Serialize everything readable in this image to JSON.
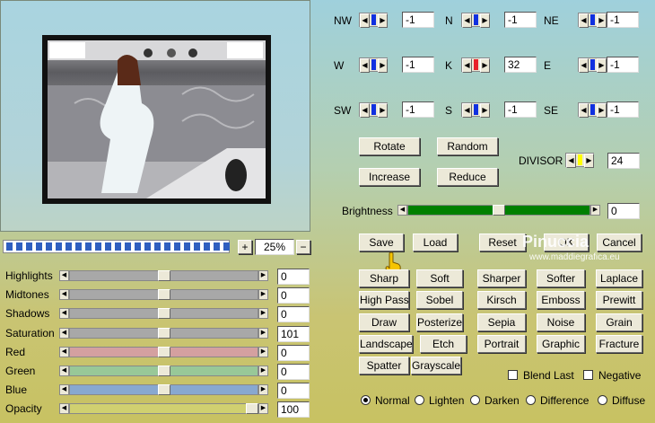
{
  "kernel": {
    "labels": {
      "nw": "NW",
      "n": "N",
      "ne": "NE",
      "w": "W",
      "k": "K",
      "e": "E",
      "sw": "SW",
      "s": "S",
      "se": "SE"
    },
    "values": {
      "nw": "-1",
      "n": "-1",
      "ne": "-1",
      "w": "-1",
      "k": "32",
      "e": "-1",
      "sw": "-1",
      "s": "-1",
      "se": "-1"
    },
    "divisor_label": "DIVISOR",
    "divisor_value": "24",
    "center_color": "#e8202a",
    "thumb_color": "#1030e0",
    "divisor_thumb_color": "#ffff00"
  },
  "buttons": {
    "rotate": "Rotate",
    "random": "Random",
    "increase": "Increase",
    "reduce": "Reduce",
    "save": "Save",
    "load": "Load",
    "reset": "Reset",
    "ok": "OK",
    "cancel": "Cancel"
  },
  "brightness": {
    "label": "Brightness",
    "value": "0",
    "fill_color": "#008000",
    "level": 0.5
  },
  "zoom": {
    "plus": "+",
    "minus": "−",
    "value": "25%",
    "progress_segments": 23
  },
  "adjust": [
    {
      "label": "Highlights",
      "value": "0",
      "color": "#a8a8a8"
    },
    {
      "label": "Midtones",
      "value": "0",
      "color": "#a8a8a8"
    },
    {
      "label": "Shadows",
      "value": "0",
      "color": "#a8a8a8"
    },
    {
      "label": "Saturation",
      "value": "101",
      "color": "#a8a8a8"
    },
    {
      "label": "Red",
      "value": "0",
      "color": "#d4a0a0"
    },
    {
      "label": "Green",
      "value": "0",
      "color": "#98c898"
    },
    {
      "label": "Blue",
      "value": "0",
      "color": "#88a8d0"
    },
    {
      "label": "Opacity",
      "value": "100",
      "color": "#d0d070"
    }
  ],
  "presets": [
    "Sharp",
    "Soft",
    "Sharper",
    "Softer",
    "Laplace",
    "High Pass",
    "Sobel",
    "Kirsch",
    "Emboss",
    "Prewitt",
    "Draw",
    "Posterize",
    "Sepia",
    "Noise",
    "Grain",
    "Landscape",
    "Etch",
    "Portrait",
    "Graphic",
    "Fracture",
    "Spatter",
    "Grayscale"
  ],
  "options": {
    "blend_last": "Blend Last",
    "negative": "Negative"
  },
  "modes": [
    "Normal",
    "Lighten",
    "Darken",
    "Difference",
    "Diffuse"
  ],
  "watermark": {
    "title": "Pinuccia",
    "sub": "www.maddiegrafica.eu"
  },
  "cursor_icon": "hand-pointer-icon"
}
